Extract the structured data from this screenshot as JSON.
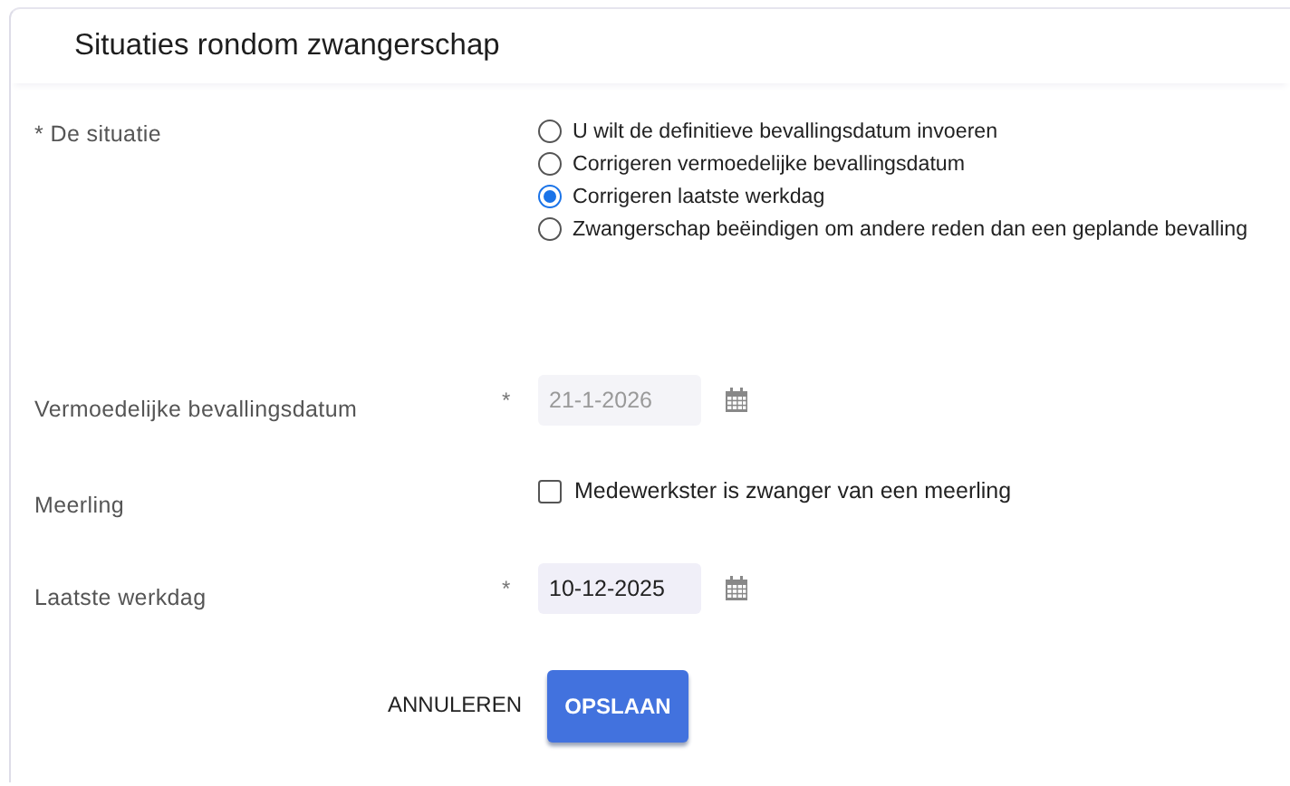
{
  "header": {
    "title": "Situaties rondom zwangerschap"
  },
  "situation": {
    "label": "* De situatie",
    "options": [
      {
        "label": "U wilt de definitieve bevallingsdatum invoeren",
        "selected": false
      },
      {
        "label": "Corrigeren vermoedelijke bevallingsdatum",
        "selected": false
      },
      {
        "label": "Corrigeren laatste werkdag",
        "selected": true
      },
      {
        "label": "Zwangerschap beëindigen om andere reden dan een geplande bevalling",
        "selected": false
      }
    ]
  },
  "fields": [
    {
      "kind": "date",
      "label": "Vermoedelijke bevallingsdatum",
      "required_mark": "*",
      "value": "21-1-2026",
      "disabled": true
    },
    {
      "kind": "checkbox",
      "label": "Meerling",
      "option": "Medewerkster is zwanger van een meerling",
      "checked": false
    },
    {
      "kind": "date",
      "label": "Laatste werkdag",
      "required_mark": "*",
      "value": "10-12-2025",
      "disabled": false
    }
  ],
  "buttons": [
    {
      "kind": "text",
      "label": "ANNULEREN"
    },
    {
      "kind": "primary",
      "label": "OPSLAAN"
    }
  ]
}
